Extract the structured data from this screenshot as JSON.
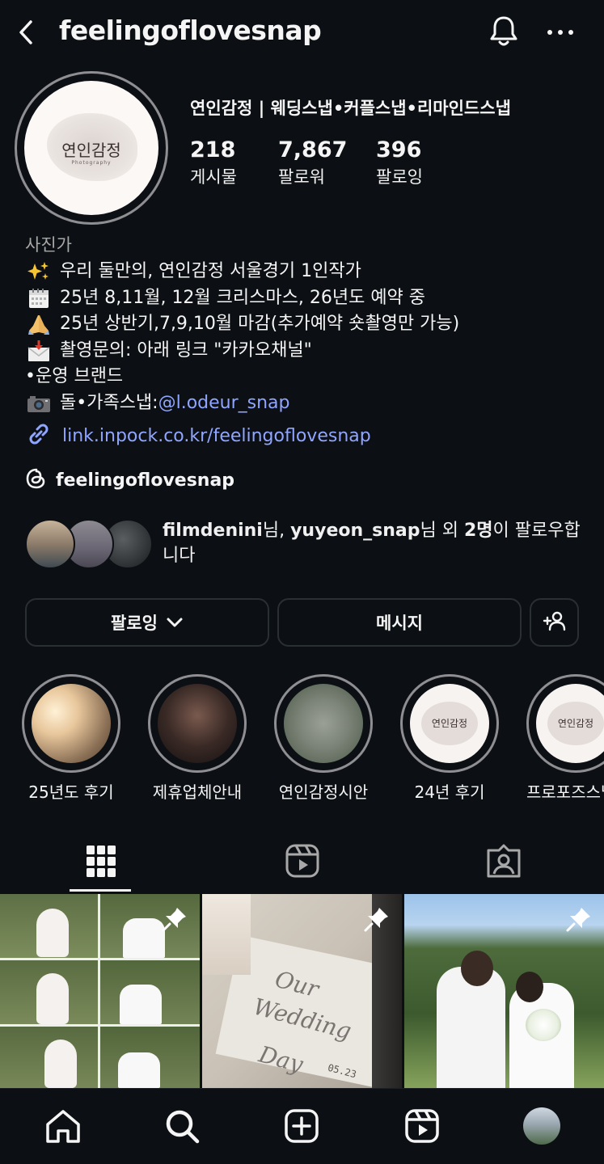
{
  "header": {
    "username": "feelingoflovesnap",
    "back_icon": "chevron-left-icon",
    "notification_icon": "bell-icon",
    "more_icon": "more-horizontal-icon"
  },
  "profile": {
    "avatar_text": "연인감정",
    "avatar_subtext": "Photography",
    "display_name": "연인감정 | 웨딩스냅•커플스냅•리마인드스냅",
    "stats": [
      {
        "value": "218",
        "label": "게시물"
      },
      {
        "value": "7,867",
        "label": "팔로워"
      },
      {
        "value": "396",
        "label": "팔로잉"
      }
    ],
    "category": "사진가",
    "bio": [
      {
        "emoji": "✨",
        "text": "우리 둘만의, 연인감정 서울경기 1인작가"
      },
      {
        "emoji": "🗓️",
        "text": "25년 8,11월, 12월 크리스마스, 26년도 예약 중"
      },
      {
        "emoji": "🙏",
        "text": "25년 상반기,7,9,10월 마감(추가예약 숏촬영만 가능)"
      },
      {
        "emoji": "📩",
        "text": "촬영문의: 아래 링크 \"카카오채널\""
      },
      {
        "emoji": "",
        "text": "•운영 브랜드"
      },
      {
        "emoji": "📷",
        "text": "돌•가족스냅: ",
        "mention": "@l.odeur_snap"
      }
    ],
    "link": "link.inpock.co.kr/feelingoflovesnap",
    "threads_handle": "feelingoflovesnap",
    "followed_by": {
      "user1": "filmdenini",
      "honorific1": "님, ",
      "user2": "yuyeon_snap",
      "honorific2": "님 외 ",
      "others_count": "2명",
      "suffix": "이 팔로우합니다"
    }
  },
  "actions": {
    "following_label": "팔로잉",
    "message_label": "메시지"
  },
  "highlights": [
    {
      "label": "25년도 후기"
    },
    {
      "label": "제휴업체안내"
    },
    {
      "label": "연인감정시안"
    },
    {
      "label": "24년 후기"
    },
    {
      "label": "프로포즈스냅"
    }
  ],
  "highlight_avatar_text": "연인감정",
  "post_texts": {
    "p2_line1": "Our",
    "p2_line2": "Wedding",
    "p2_line3": "Day",
    "p2_date": "05.23"
  },
  "tabs": [
    {
      "icon": "grid-icon",
      "active": true
    },
    {
      "icon": "reels-icon",
      "active": false
    },
    {
      "icon": "tagged-icon",
      "active": false
    }
  ],
  "bottom_nav": [
    {
      "icon": "home-icon"
    },
    {
      "icon": "search-icon"
    },
    {
      "icon": "create-icon"
    },
    {
      "icon": "reels-icon"
    },
    {
      "icon": "profile-avatar-icon"
    }
  ]
}
